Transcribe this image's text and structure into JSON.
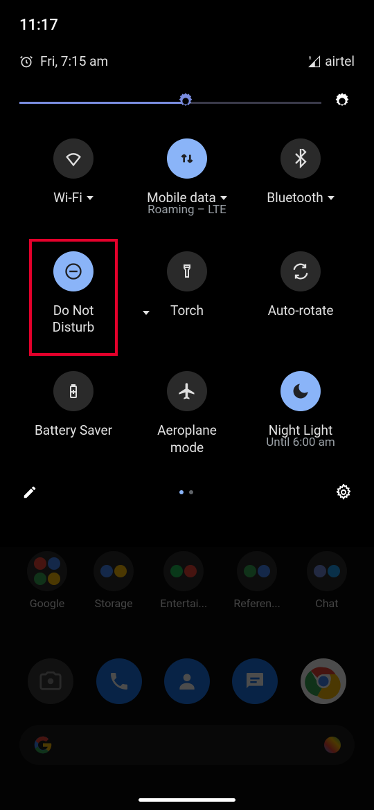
{
  "status": {
    "time": "11:17"
  },
  "header": {
    "date": "Fri, 7:15 am",
    "carrier": "airtel"
  },
  "brightness": {
    "value_pct": 55
  },
  "tiles": [
    {
      "id": "wifi",
      "label": "Wi-Fi",
      "active": false,
      "has_caret": true
    },
    {
      "id": "mobile-data",
      "label": "Mobile data",
      "sublabel": "Roaming – LTE",
      "active": true,
      "has_caret": true
    },
    {
      "id": "bluetooth",
      "label": "Bluetooth",
      "active": false,
      "has_caret": true
    },
    {
      "id": "dnd",
      "label": "Do Not Disturb",
      "active": true,
      "has_caret": true,
      "highlighted": true
    },
    {
      "id": "torch",
      "label": "Torch",
      "active": false,
      "has_caret": false
    },
    {
      "id": "autorotate",
      "label": "Auto-rotate",
      "active": false,
      "has_caret": false
    },
    {
      "id": "battery-saver",
      "label": "Battery Saver",
      "active": false,
      "has_caret": false
    },
    {
      "id": "aeroplane",
      "label": "Aeroplane mode",
      "active": false,
      "has_caret": false
    },
    {
      "id": "night-light",
      "label": "Night Light",
      "sublabel": "Until 6:00 am",
      "active": true,
      "has_caret": false
    }
  ],
  "folders": [
    {
      "label": "Google"
    },
    {
      "label": "Storage"
    },
    {
      "label": "Entertai..."
    },
    {
      "label": "Referen..."
    },
    {
      "label": "Chat"
    }
  ],
  "colors": {
    "accent": "#8ab4f8",
    "highlight": "#e4002b",
    "tile_off": "#2a2a2a"
  }
}
